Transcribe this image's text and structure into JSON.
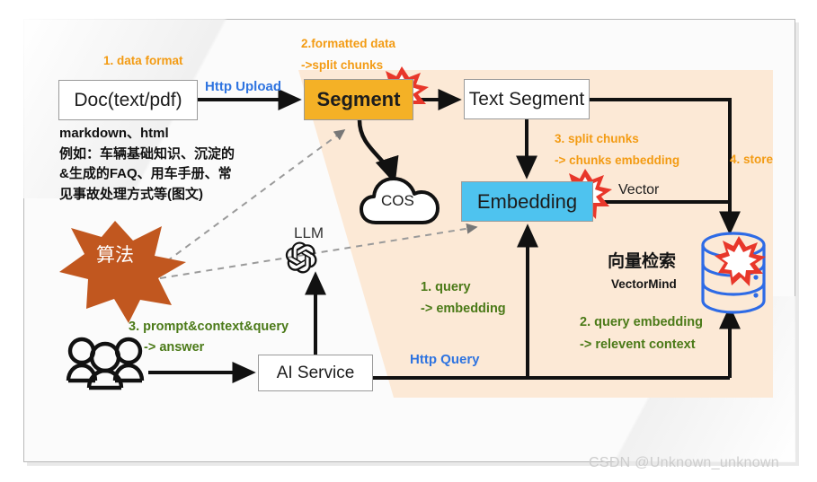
{
  "diagram": {
    "title": "RAG knowledge-base architecture",
    "watermark": "CSDN @Unknown_unknown"
  },
  "colors": {
    "segment_fill": "#F4B126",
    "embedding_fill": "#4EC3EF",
    "region_fill": "#FCE9D6",
    "orange_text": "#F39B13",
    "blue_text": "#2F74E0",
    "green_text": "#4B7A18",
    "star_outline": "#E8372A",
    "starburst_fill": "#C1571F",
    "db_outline": "#2E6BE6",
    "card_border": "#b9b9b9"
  },
  "nodes": {
    "doc": "Doc(text/pdf)",
    "segment": "Segment",
    "text_segment": "Text Segment",
    "embedding": "Embedding",
    "ai_service": "AI Service",
    "cos": "COS",
    "llm": "LLM",
    "vector_db_cn": "向量检索",
    "vector_db_en": "VectorMind",
    "algorithm_badge": "算法"
  },
  "doc_notes": {
    "line1": "markdown、html",
    "line2": "例如：车辆基础知识、沉淀的",
    "line3": "&生成的FAQ、用车手册、常",
    "line4": "见事故处理方式等(图文)"
  },
  "edge_labels": {
    "data_format": "1. data format",
    "formatted_data": "2.formatted data",
    "split_chunks_arrow": "->split chunks",
    "http_upload": "Http Upload",
    "split_chunks": "3. split chunks",
    "chunks_embedding": "-> chunks embedding",
    "store": "4. store",
    "vector": "Vector",
    "query": "1. query",
    "query_embedding_arrow": "-> embedding",
    "query_embedding": "2.  query embedding",
    "relevent_context": "-> relevent context",
    "prompt_context_query": "3. prompt&context&query",
    "answer": "-> answer",
    "http_query": "Http Query"
  },
  "icons": {
    "users": "users-icon",
    "openai": "openai-logo-icon",
    "cloud": "cloud-icon",
    "database": "database-cylinder-icon",
    "burst_segment": "star-burst-icon",
    "burst_embedding": "star-burst-icon",
    "burst_database": "star-burst-icon"
  }
}
